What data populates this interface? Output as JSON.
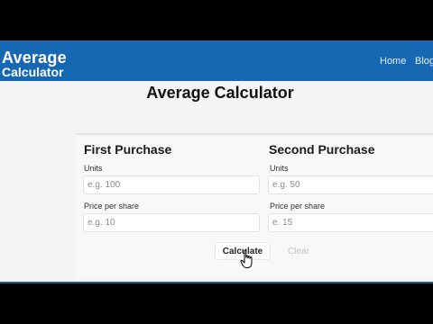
{
  "header": {
    "logo_line1": "Average",
    "logo_line2": "Calculator",
    "nav": {
      "home": "Home",
      "blog": "Blog"
    }
  },
  "main": {
    "title": "Average Calculator",
    "first": {
      "heading": "First Purchase",
      "units_label": "Units",
      "units_placeholder": "e.g. 100",
      "price_label": "Price per share",
      "price_placeholder": "e.g. 10"
    },
    "second": {
      "heading": "Second Purchase",
      "units_label": "Units",
      "units_placeholder": "e.g. 50",
      "price_label": "Price per share",
      "price_placeholder": "e. 15"
    },
    "calculate_label": "Calculate",
    "clear_label": "Clear"
  },
  "colors": {
    "brand": "#1768b3",
    "background": "#f4f4f4"
  },
  "icons": {
    "cursor": "hand-pointer-icon"
  }
}
